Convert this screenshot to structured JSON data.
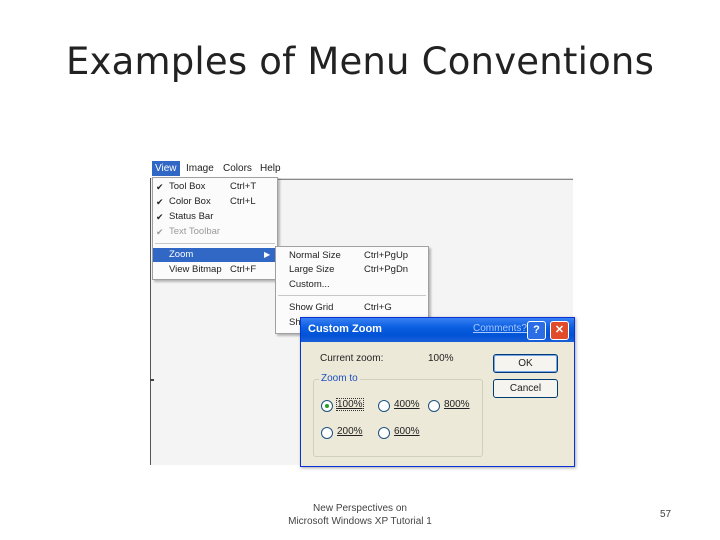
{
  "slide": {
    "title": "Examples of Menu Conventions",
    "footer_line1": "New Perspectives on",
    "footer_line2": "Microsoft Windows XP Tutorial 1",
    "page_number": "57"
  },
  "menubar": {
    "items": [
      "View",
      "Image",
      "Colors",
      "Help"
    ],
    "active": "View"
  },
  "view_menu": {
    "items": [
      {
        "label": "Tool Box",
        "shortcut": "Ctrl+T",
        "checked": "✔"
      },
      {
        "label": "Color Box",
        "shortcut": "Ctrl+L",
        "checked": "✔"
      },
      {
        "label": "Status Bar",
        "shortcut": "",
        "checked": "✔"
      },
      {
        "label": "Text Toolbar",
        "shortcut": "",
        "checked": "✔",
        "state": "disabled"
      },
      {
        "label": "Zoom",
        "shortcut": "",
        "submenu_arrow": "▶",
        "state": "highlighted"
      },
      {
        "label": "View Bitmap",
        "shortcut": "Ctrl+F"
      }
    ]
  },
  "zoom_submenu": {
    "items": [
      {
        "label": "Normal Size",
        "shortcut": "Ctrl+PgUp"
      },
      {
        "label": "Large Size",
        "shortcut": "Ctrl+PgDn"
      },
      {
        "label": "Custom...",
        "shortcut": ""
      },
      {
        "label": "Show Grid",
        "shortcut": "Ctrl+G"
      },
      {
        "label": "Sh",
        "shortcut": ""
      }
    ]
  },
  "custom_zoom_dialog": {
    "title": "Custom Zoom",
    "comments_link": "Comments?",
    "help_button": "?",
    "close_button": "✕",
    "current_zoom_label": "Current zoom:",
    "current_zoom_value": "100%",
    "ok_label": "OK",
    "cancel_label": "Cancel",
    "group_label": "Zoom to",
    "options": [
      "100%",
      "400%",
      "800%",
      "200%",
      "600%"
    ],
    "selected": "100%"
  },
  "colors": {
    "menu_highlight": "#3168c5",
    "dialog_title_bar": "#0053d6",
    "dialog_background": "#ece9d8",
    "close_button": "#e24b2a"
  }
}
